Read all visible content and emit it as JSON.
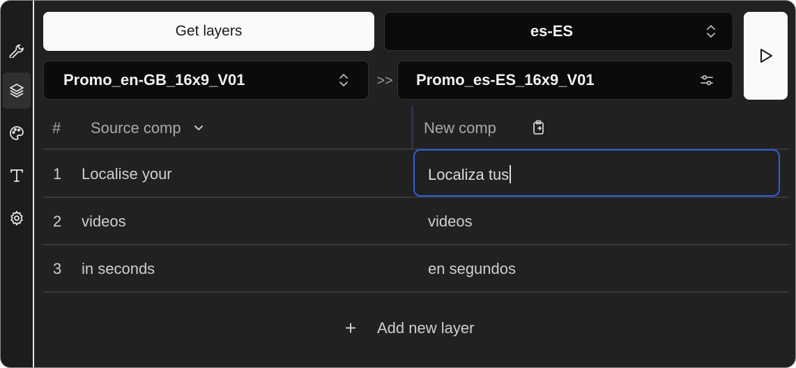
{
  "toolbar": {
    "get_layers_label": "Get layers",
    "language_value": "es-ES",
    "source_comp_value": "Promo_en-GB_16x9_V01",
    "arrow_glyph": ">>",
    "new_comp_value": "Promo_es-ES_16x9_V01",
    "run_icon": "play-icon"
  },
  "sidebar": {
    "items": [
      {
        "icon": "wrench-icon",
        "active": false
      },
      {
        "icon": "layers-icon",
        "active": true
      },
      {
        "icon": "palette-icon",
        "active": false
      },
      {
        "icon": "text-icon",
        "active": false
      },
      {
        "icon": "gear-icon",
        "active": false
      }
    ]
  },
  "table": {
    "headers": {
      "index": "#",
      "source": "Source comp",
      "new": "New comp"
    },
    "rows": [
      {
        "index": "1",
        "source": "Localise your",
        "new": "Localiza tus"
      },
      {
        "index": "2",
        "source": "videos",
        "new": "videos"
      },
      {
        "index": "3",
        "source": "in seconds",
        "new": "en segundos"
      }
    ],
    "add_layer_label": "Add new layer",
    "add_layer_glyph": "+"
  },
  "colors": {
    "background": "#212121",
    "focus_border": "#2f5fd8",
    "light_button": "#fafafa"
  }
}
